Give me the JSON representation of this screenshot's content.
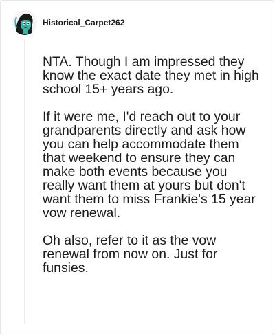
{
  "comment": {
    "username": "Historical_Carpet262",
    "avatar_icon": "snoo-avatar-icon",
    "paragraphs": [
      "NTA. Though I am impressed they know the exact date they met in high school 15+ years ago.",
      "If it were me, I'd reach out to your grandparents directly and ask how you can help accommodate them that weekend to ensure they can make both events because you really want them at yours but don't want them to miss Frankie's 15 year vow renewal.",
      "Oh also, refer to it as the vow renewal from now on. Just for funsies."
    ]
  },
  "colors": {
    "avatar_bg": "#1a1a1a",
    "avatar_accent": "#2fb8a8",
    "text": "#1c1c1c",
    "thread_line": "#ececec"
  }
}
